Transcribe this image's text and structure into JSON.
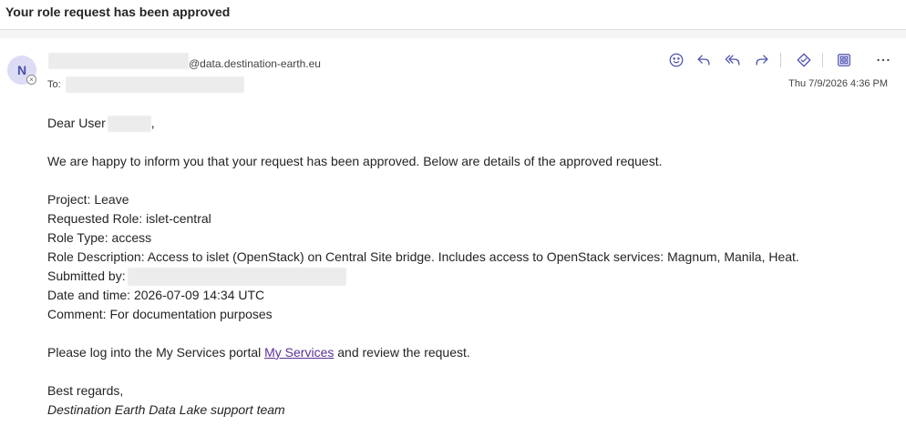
{
  "email": {
    "subject": "Your role request has been approved",
    "avatar_initial": "N",
    "from_domain": "@data.destination-earth.eu",
    "to_label": "To:",
    "date": "Thu 7/9/2026 4:36 PM",
    "greeting_prefix": "Dear User",
    "greeting_suffix": ",",
    "intro": "We are happy to inform you that your request has been approved. Below are details of the approved request.",
    "details": {
      "project": "Project: Leave",
      "requested_role": "Requested Role: islet-central",
      "role_type": "Role Type: access",
      "role_description": "Role Description: Access to islet (OpenStack) on Central Site bridge. Includes access to OpenStack services: Magnum, Manila, Heat.",
      "submitted_by": "Submitted by:",
      "date_time": "Date and time: 2026-07-09 14:34 UTC",
      "comment": "Comment: For documentation purposes"
    },
    "portal_prefix": "Please log into the My Services portal ",
    "portal_link": "My Services",
    "portal_suffix": " and review the request.",
    "closing": "Best regards,",
    "signature": "Destination Earth Data Lake support team"
  },
  "toolbar": {
    "icons": [
      "emoji-icon",
      "reply-icon",
      "reply-all-icon",
      "forward-icon",
      "tag-icon",
      "apps-icon",
      "more-icon"
    ]
  },
  "colors": {
    "accent": "#4f52b2",
    "link": "#5b2f9a",
    "avatar_bg": "#dcdcf5"
  }
}
